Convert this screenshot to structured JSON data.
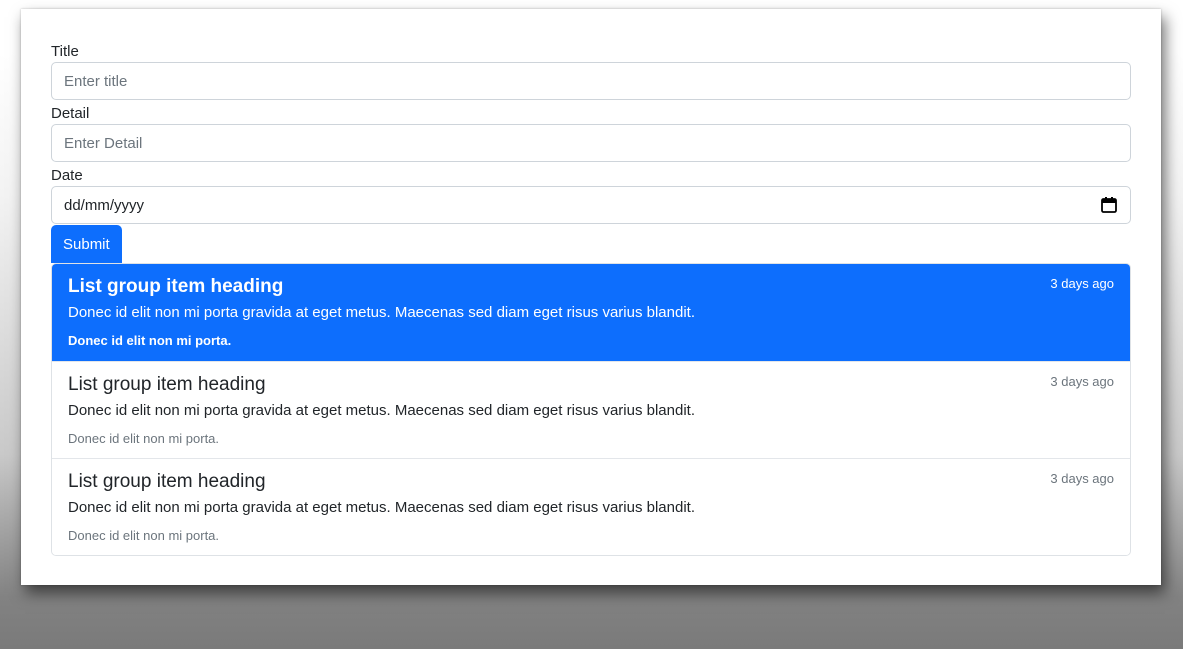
{
  "form": {
    "title_label": "Title",
    "title_placeholder": "Enter title",
    "detail_label": "Detail",
    "detail_placeholder": "Enter Detail",
    "date_label": "Date",
    "date_value": "dd/mm/yyyy",
    "submit_label": "Submit"
  },
  "colors": {
    "primary": "#0d6efd",
    "border": "#ced4da",
    "muted": "#6c757d"
  },
  "list": {
    "items": [
      {
        "heading": "List group item heading",
        "time": "3 days ago",
        "text": "Donec id elit non mi porta gravida at eget metus. Maecenas sed diam eget risus varius blandit.",
        "small": "Donec id elit non mi porta.",
        "active": true
      },
      {
        "heading": "List group item heading",
        "time": "3 days ago",
        "text": "Donec id elit non mi porta gravida at eget metus. Maecenas sed diam eget risus varius blandit.",
        "small": "Donec id elit non mi porta.",
        "active": false
      },
      {
        "heading": "List group item heading",
        "time": "3 days ago",
        "text": "Donec id elit non mi porta gravida at eget metus. Maecenas sed diam eget risus varius blandit.",
        "small": "Donec id elit non mi porta.",
        "active": false
      }
    ]
  }
}
